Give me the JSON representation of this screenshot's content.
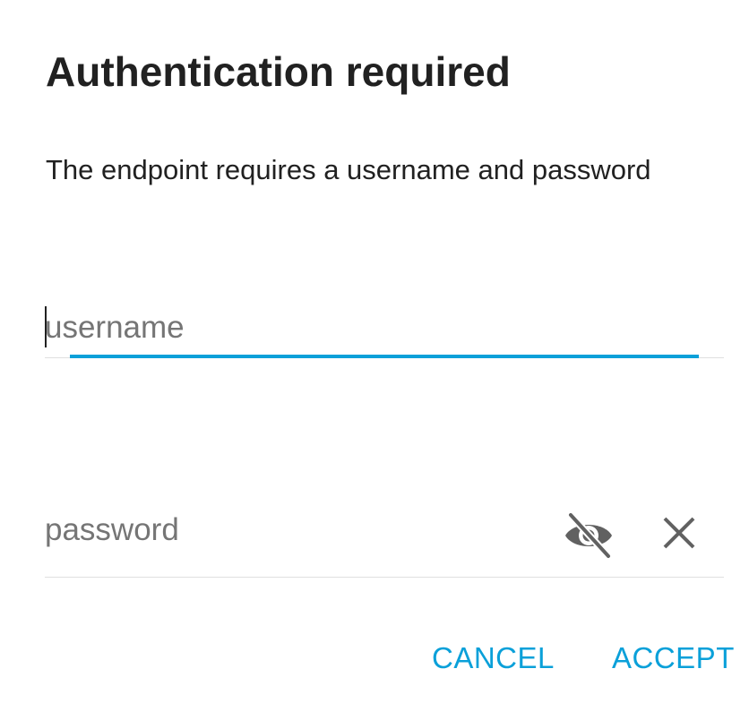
{
  "dialog": {
    "title": "Authentication required",
    "message": "The endpoint requires a username and password"
  },
  "username": {
    "placeholder": "username",
    "value": ""
  },
  "password": {
    "placeholder": "password",
    "value": "",
    "visibility_icon": "visibility-off-icon",
    "clear_icon": "close-icon"
  },
  "actions": {
    "cancel_label": "CANCEL",
    "accept_label": "ACCEPT"
  },
  "colors": {
    "accent": "#0aa0d9",
    "text": "#212121",
    "placeholder": "#757575",
    "icon": "#616161"
  }
}
